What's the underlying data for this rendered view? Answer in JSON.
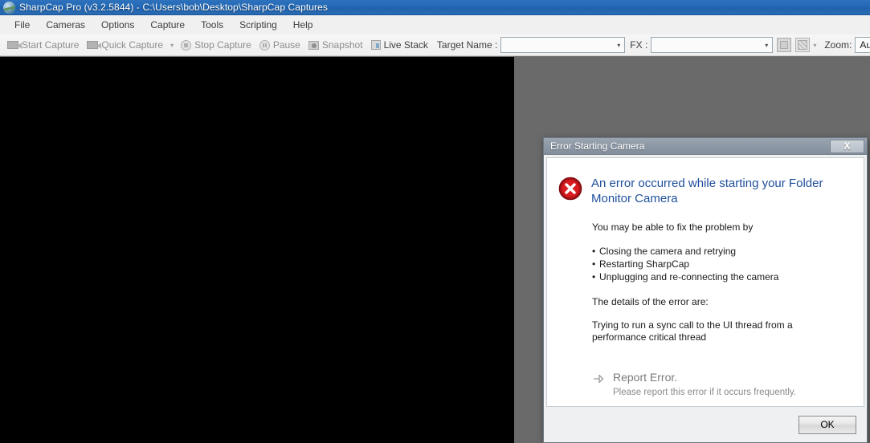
{
  "window": {
    "title": "SharpCap Pro (v3.2.5844) - C:\\Users\\bob\\Desktop\\SharpCap Captures",
    "app_icon": "planet-icon"
  },
  "menubar": {
    "items": [
      {
        "label": "File"
      },
      {
        "label": "Cameras"
      },
      {
        "label": "Options"
      },
      {
        "label": "Capture"
      },
      {
        "label": "Tools"
      },
      {
        "label": "Scripting"
      },
      {
        "label": "Help"
      }
    ]
  },
  "toolbar": {
    "start_capture": "Start Capture",
    "quick_capture": "Quick Capture",
    "quick_capture_arrow": "▾",
    "stop_capture": "Stop Capture",
    "pause": "Pause",
    "snapshot": "Snapshot",
    "live_stack": "Live Stack",
    "target_name_label": "Target Name :",
    "target_name_value": "",
    "fx_label": "FX :",
    "fx_value": "",
    "display_toggle_arrow": "▾",
    "zoom_label": "Zoom:",
    "zoom_value": "Auto",
    "combo_arrow": "▾"
  },
  "preview": {
    "background_color": "#000000"
  },
  "workspace": {
    "background_color": "#6a6a6a"
  },
  "dialog": {
    "title": "Error Starting Camera",
    "close_label": "X",
    "heading": "An error occurred while starting your Folder Monitor Camera",
    "intro": "You may be able to fix the problem by",
    "bullets": [
      "Closing the camera and retrying",
      "Restarting SharpCap",
      "Unplugging and re-connecting the camera"
    ],
    "details_label": "The details of the error are:",
    "details_text": "Trying to run a sync call to the UI thread from a performance critical thread",
    "report_link": "Report Error.",
    "report_sub": "Please report this error if it occurs frequently.",
    "ok_label": "OK",
    "heading_color": "#1f4f9c",
    "error_icon_color": "#cc0000"
  }
}
